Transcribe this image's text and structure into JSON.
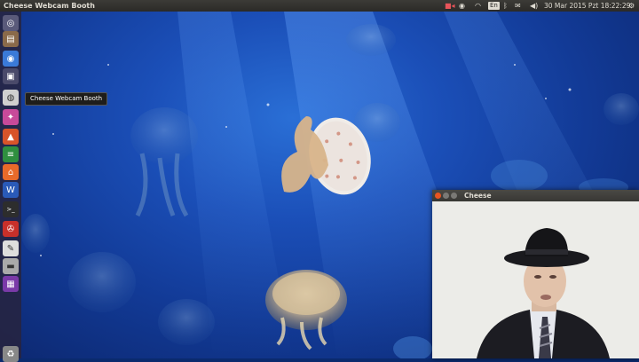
{
  "panel": {
    "app_title": "Cheese Webcam Booth",
    "clock": "30 Mar 2015 Pzt 18:22:29",
    "indicators": {
      "camera": "camera-icon",
      "chrome": "chrome-icon",
      "network": "wifi-icon",
      "keyboard_layout": "En",
      "bluetooth": "bluetooth-icon",
      "messages": "envelope-icon",
      "sound": "speaker-icon",
      "session": "gear-icon"
    }
  },
  "launcher": {
    "tooltip": "Cheese Webcam Booth",
    "items": [
      {
        "name": "dash-home",
        "icon": "ubuntu-logo-icon",
        "color": "#5a5a7a"
      },
      {
        "name": "files",
        "icon": "folder-icon",
        "color": "#8a6a4a"
      },
      {
        "name": "chromium",
        "icon": "chrome-icon",
        "color": "#3a7ad8"
      },
      {
        "name": "shotwell",
        "icon": "photo-icon",
        "color": "#4a4a6a"
      },
      {
        "name": "cheese",
        "icon": "webcam-icon",
        "color": "#d0d0d0"
      },
      {
        "name": "empathy",
        "icon": "chat-icon",
        "color": "#c74a9a"
      },
      {
        "name": "software-center",
        "icon": "shopping-bag-icon",
        "color": "#d8542a"
      },
      {
        "name": "system-settings",
        "icon": "sliders-icon",
        "color": "#2f8f3f"
      },
      {
        "name": "ubuntu-store",
        "icon": "bag-icon",
        "color": "#e86a2a"
      },
      {
        "name": "word",
        "icon": "word-icon",
        "color": "#2a5ab8"
      },
      {
        "name": "terminal",
        "icon": "terminal-icon",
        "color": "#2d2d2d"
      },
      {
        "name": "remote",
        "icon": "remote-icon",
        "color": "#c8302a"
      },
      {
        "name": "text-editor",
        "icon": "pencil-icon",
        "color": "#dedede"
      },
      {
        "name": "drive",
        "icon": "drive-icon",
        "color": "#aaaaaa"
      },
      {
        "name": "workspaces",
        "icon": "workspace-icon",
        "color": "#7a3aa8"
      },
      {
        "name": "trash",
        "icon": "trash-icon",
        "color": "#888888"
      }
    ]
  },
  "cheese_window": {
    "title": "Cheese"
  },
  "colors": {
    "panel_bg": "#3c3b37",
    "close_button": "#e95420",
    "wallpaper_blue": "#1b4fb8"
  }
}
